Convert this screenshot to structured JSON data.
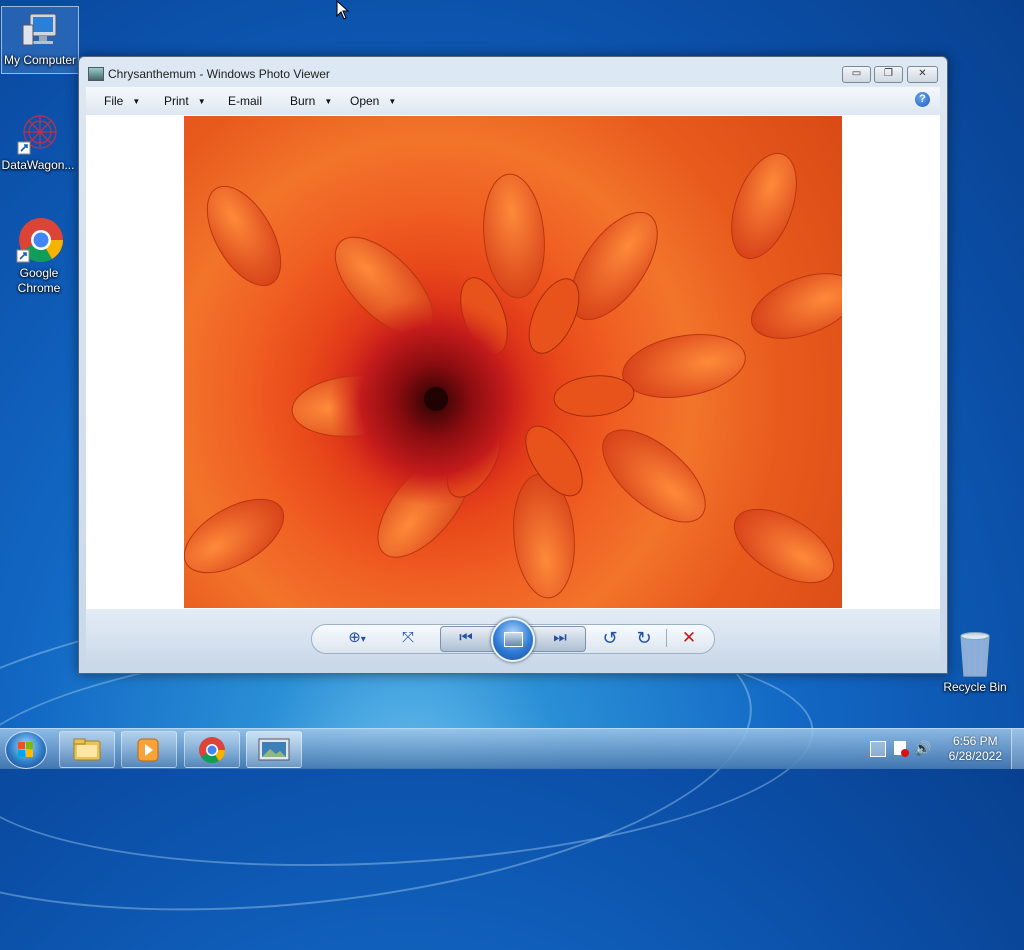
{
  "desktop": {
    "icons": [
      {
        "label": "My Computer"
      },
      {
        "label": "DataWagon..."
      },
      {
        "label": "Google Chrome"
      },
      {
        "label": "Recycle Bin"
      }
    ]
  },
  "window": {
    "title": "Chrysanthemum - Windows Photo Viewer",
    "controls": {
      "minimize": "▭",
      "maximize": "❐",
      "close": "✕"
    },
    "menu": [
      {
        "label": "File",
        "has_dropdown": true
      },
      {
        "label": "Print",
        "has_dropdown": true
      },
      {
        "label": "E-mail",
        "has_dropdown": false
      },
      {
        "label": "Burn",
        "has_dropdown": true
      },
      {
        "label": "Open",
        "has_dropdown": true
      }
    ],
    "help_glyph": "?",
    "photo": {
      "subject": "Chrysanthemum",
      "colors": {
        "center": "#5a0808",
        "petals": "#f06a24"
      }
    },
    "toolbar": {
      "zoom_glyph": "⊕",
      "zoom_arrow": "▾",
      "fit_glyph": "⤧",
      "previous_glyph": "⏮",
      "next_glyph": "⏭",
      "rotate_ccw_glyph": "↺",
      "rotate_cw_glyph": "↻",
      "delete_glyph": "✕"
    }
  },
  "taskbar": {
    "clock_time": "6:56 PM",
    "clock_date": "6/28/2022",
    "colors": {
      "accent": "#1268c4"
    }
  }
}
